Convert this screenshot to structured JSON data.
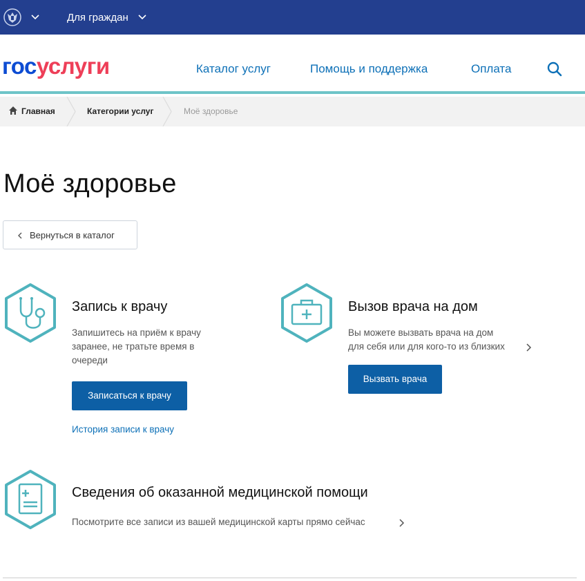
{
  "topbar": {
    "for_citizens": "Для граждан",
    "bg_color": "#233f8f"
  },
  "header": {
    "logo_gos": "гос",
    "logo_uslugi": "услуги",
    "nav": [
      "Каталог услуг",
      "Помощь и поддержка",
      "Оплата"
    ],
    "accent_color": "#6ec4c8"
  },
  "breadcrumbs": {
    "home": "Главная",
    "categories": "Категории услуг",
    "current": "Моё здоровье"
  },
  "page": {
    "title": "Моё здоровье",
    "back_label": "Вернуться в каталог"
  },
  "services": {
    "doctor_appointment": {
      "title": "Запись к врачу",
      "desc_line1": "Запишитесь на приём к врачу",
      "desc_line2": "заранее, не тратьте время в",
      "desc_line3": "очереди",
      "button": "Записаться к врачу",
      "history_link": "История записи к врачу",
      "icon": "stethoscope-icon"
    },
    "home_visit": {
      "title": "Вызов врача на дом",
      "desc_line1": "Вы можете вызвать врача на дом",
      "desc_line2": "для себя или для кого-то из близких",
      "button": "Вызвать врача",
      "icon": "medkit-icon"
    },
    "medical_records": {
      "title": "Сведения об оказанной медицинской помощи",
      "desc": "Посмотрите все записи из вашей медицинской карты прямо сейчас",
      "icon": "medical-record-icon"
    }
  },
  "colors": {
    "button": "#0d5fa5",
    "link": "#0d70b7",
    "icon_teal": "#4fb3bd",
    "logo_blue": "#0d4cd3",
    "logo_red": "#ee3f58"
  }
}
